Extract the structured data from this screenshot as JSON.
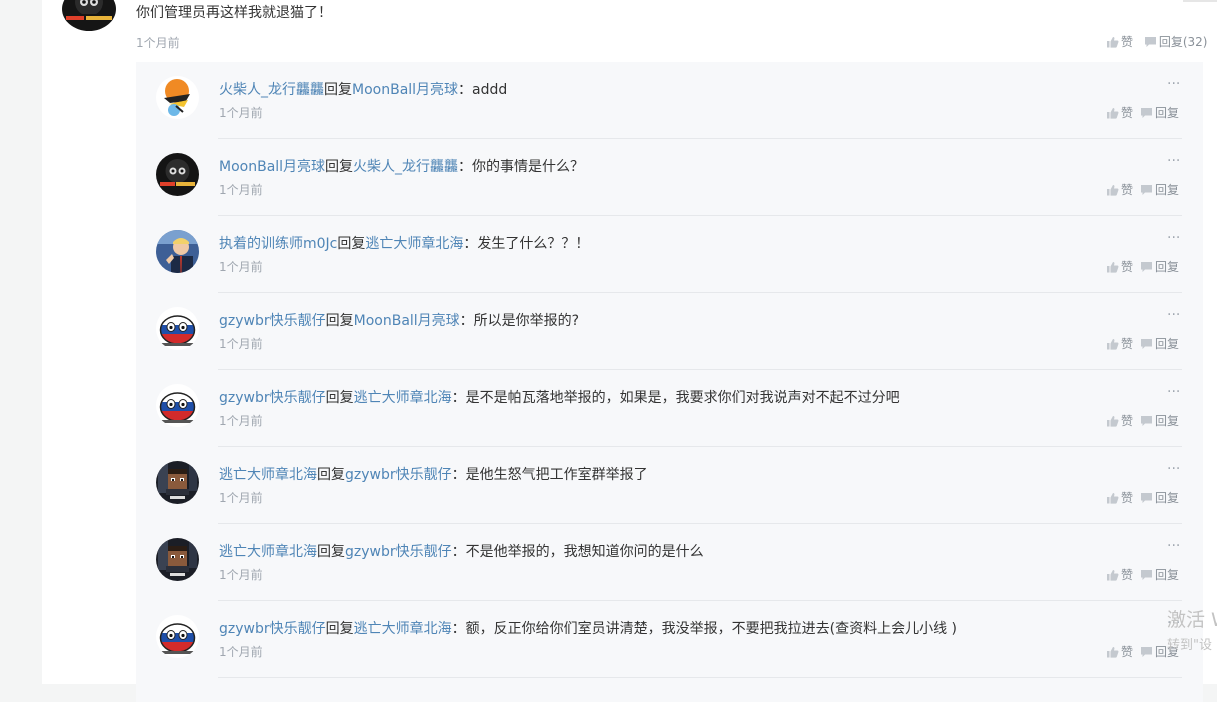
{
  "main_comment": {
    "text": "你们管理员再这样我就退猫了！",
    "time": "1个月前",
    "like_label": "赞",
    "reply_label": "回复(32)"
  },
  "reply_word": "回复",
  "replies": [
    {
      "user": "火柴人_龙行龘龘",
      "target": "MoonBall月亮球",
      "text": "：addd",
      "time": "1个月前",
      "like": "赞",
      "reply": "回复",
      "more": "···",
      "avatar": "stickman-avatar"
    },
    {
      "user": "MoonBall月亮球",
      "target": "火柴人_龙行龘龘",
      "text": "：你的事情是什么？",
      "time": "1个月前",
      "like": "赞",
      "reply": "回复",
      "more": "···",
      "avatar": "moonball-avatar"
    },
    {
      "user": "执着的训练师m0Jc",
      "target": "逃亡大师章北海",
      "text": "：发生了什么？？！",
      "time": "1个月前",
      "like": "赞",
      "reply": "回复",
      "more": "···",
      "avatar": "trainer-avatar"
    },
    {
      "user": "gzywbr快乐靓仔",
      "target": "MoonBall月亮球",
      "text": "：所以是你举报的?",
      "time": "1个月前",
      "like": "赞",
      "reply": "回复",
      "more": "···",
      "avatar": "countryball-avatar"
    },
    {
      "user": "gzywbr快乐靓仔",
      "target": "逃亡大师章北海",
      "text": "：是不是帕瓦落地举报的，如果是，我要求你们对我说声对不起不过分吧",
      "time": "1个月前",
      "like": "赞",
      "reply": "回复",
      "more": "···",
      "avatar": "countryball-avatar"
    },
    {
      "user": "逃亡大师章北海",
      "target": "gzywbr快乐靓仔",
      "text": "：是他生怒气把工作室群举报了",
      "time": "1个月前",
      "like": "赞",
      "reply": "回复",
      "more": "···",
      "avatar": "blockman-avatar"
    },
    {
      "user": "逃亡大师章北海",
      "target": "gzywbr快乐靓仔",
      "text": "：不是他举报的，我想知道你问的是什么",
      "time": "1个月前",
      "like": "赞",
      "reply": "回复",
      "more": "···",
      "avatar": "blockman-avatar"
    },
    {
      "user": "gzywbr快乐靓仔",
      "target": "逃亡大师章北海",
      "text": "：额，反正你给你们室员讲清楚，我没举报，不要把我拉进去(查资料上会儿小线 )",
      "time": "1个月前",
      "like": "赞",
      "reply": "回复",
      "more": "···",
      "avatar": "countryball-avatar"
    }
  ],
  "watermark": {
    "line1": "激活 W",
    "line2": "转到\"设"
  }
}
